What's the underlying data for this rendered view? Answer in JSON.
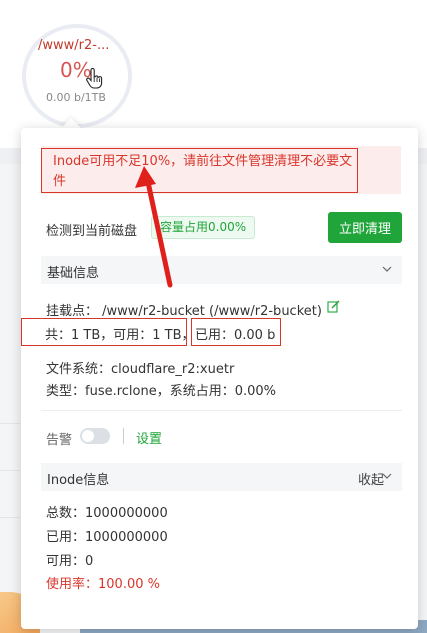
{
  "disk": {
    "path": "/www/r2-...",
    "percent": "0%",
    "size": "0.00 b/1TB"
  },
  "popup": {
    "alert": "Inode可用不足10%，请前往文件管理清理不必要文件",
    "detect_label": "检测到当前磁盘",
    "usage_badge": "容量占用0.00%",
    "clean_button": "立即清理",
    "basic_section": {
      "title": "基础信息",
      "mount": "挂载点： /www/r2-bucket (/www/r2-bucket)",
      "capacity": "共：1 TB，可用：1 TB，",
      "used": "已用：0.00 b",
      "filesystem": "文件系统：cloudflare_r2:xuetr",
      "type": "类型：fuse.rclone，系统占用：0.00%"
    },
    "alarm": {
      "label": "告警",
      "enabled": false,
      "settings_link": "设置"
    },
    "inode_section": {
      "title": "Inode信息",
      "collapse_label": "收起",
      "total": "总数：1000000000",
      "used": "已用：1000000000",
      "available": "可用：0",
      "usage_rate": "使用率：100.00 %"
    }
  },
  "colors": {
    "accent_green": "#20a53a",
    "alert_red": "#d9362b",
    "alert_bg": "#fdecec"
  }
}
